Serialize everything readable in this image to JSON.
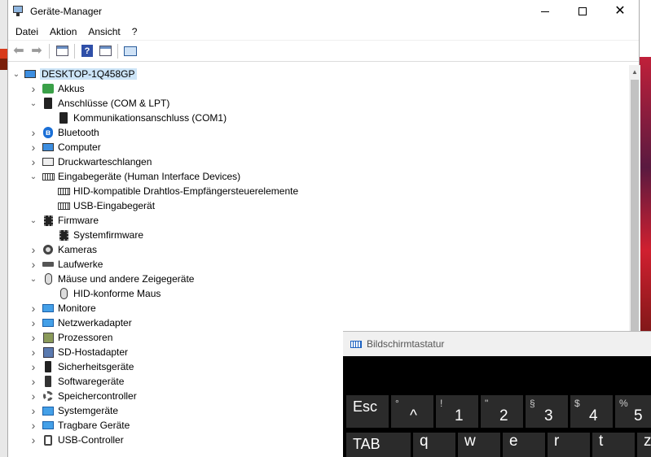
{
  "window": {
    "title": "Geräte-Manager",
    "close_glyph": "✕"
  },
  "menu": [
    "Datei",
    "Aktion",
    "Ansicht",
    "?"
  ],
  "toolbar": {
    "back_icon": "arrow-left-icon",
    "forward_icon": "arrow-right-icon",
    "help_glyph": "?"
  },
  "tree": {
    "root": "DESKTOP-1Q458GP",
    "items": [
      {
        "label": "Akkus",
        "level": 1,
        "expanded": false,
        "icon": "battery-icon"
      },
      {
        "label": "Anschlüsse (COM & LPT)",
        "level": 1,
        "expanded": true,
        "icon": "port-icon"
      },
      {
        "label": "Kommunikationsanschluss (COM1)",
        "level": 2,
        "icon": "port-icon"
      },
      {
        "label": "Bluetooth",
        "level": 1,
        "expanded": false,
        "icon": "bluetooth-icon"
      },
      {
        "label": "Computer",
        "level": 1,
        "expanded": false,
        "icon": "computer-icon"
      },
      {
        "label": "Druckwarteschlangen",
        "level": 1,
        "expanded": false,
        "icon": "printer-icon"
      },
      {
        "label": "Eingabegeräte (Human Interface Devices)",
        "level": 1,
        "expanded": true,
        "icon": "keyboard-icon"
      },
      {
        "label": "HID-kompatible Drahtlos-Empfängersteuerelemente",
        "level": 2,
        "icon": "keyboard-icon"
      },
      {
        "label": "USB-Eingabegerät",
        "level": 2,
        "icon": "keyboard-icon"
      },
      {
        "label": "Firmware",
        "level": 1,
        "expanded": true,
        "icon": "chip-icon"
      },
      {
        "label": "Systemfirmware",
        "level": 2,
        "icon": "chip-icon"
      },
      {
        "label": "Kameras",
        "level": 1,
        "expanded": false,
        "icon": "camera-icon"
      },
      {
        "label": "Laufwerke",
        "level": 1,
        "expanded": false,
        "icon": "drive-icon"
      },
      {
        "label": "Mäuse und andere Zeigegeräte",
        "level": 1,
        "expanded": true,
        "icon": "mouse-icon"
      },
      {
        "label": "HID-konforme Maus",
        "level": 2,
        "icon": "mouse-icon"
      },
      {
        "label": "Monitore",
        "level": 1,
        "expanded": false,
        "icon": "monitor-icon"
      },
      {
        "label": "Netzwerkadapter",
        "level": 1,
        "expanded": false,
        "icon": "network-icon"
      },
      {
        "label": "Prozessoren",
        "level": 1,
        "expanded": false,
        "icon": "cpu-icon"
      },
      {
        "label": "SD-Hostadapter",
        "level": 1,
        "expanded": false,
        "icon": "sd-card-icon"
      },
      {
        "label": "Sicherheitsgeräte",
        "level": 1,
        "expanded": false,
        "icon": "security-icon"
      },
      {
        "label": "Softwaregeräte",
        "level": 1,
        "expanded": false,
        "icon": "software-icon"
      },
      {
        "label": "Speichercontroller",
        "level": 1,
        "expanded": false,
        "icon": "gear-icon"
      },
      {
        "label": "Systemgeräte",
        "level": 1,
        "expanded": false,
        "icon": "system-icon"
      },
      {
        "label": "Tragbare Geräte",
        "level": 1,
        "expanded": false,
        "icon": "monitor-icon"
      },
      {
        "label": "USB-Controller",
        "level": 1,
        "expanded": false,
        "icon": "usb-icon"
      }
    ]
  },
  "osk": {
    "title": "Bildschirmtastatur",
    "row1": [
      {
        "secondary": "",
        "primary": "Esc"
      },
      {
        "secondary": "°",
        "primary": "^"
      },
      {
        "secondary": "!",
        "primary": "1"
      },
      {
        "secondary": "\"",
        "primary": "2"
      },
      {
        "secondary": "§",
        "primary": "3"
      },
      {
        "secondary": "$",
        "primary": "4"
      },
      {
        "secondary": "%",
        "primary": "5"
      }
    ],
    "row2": [
      "TAB",
      "q",
      "w",
      "e",
      "r",
      "t",
      "z"
    ]
  },
  "colors": {
    "selection": "#cce4f7",
    "osk_background": "#000000",
    "osk_key": "#2b2b2b"
  }
}
